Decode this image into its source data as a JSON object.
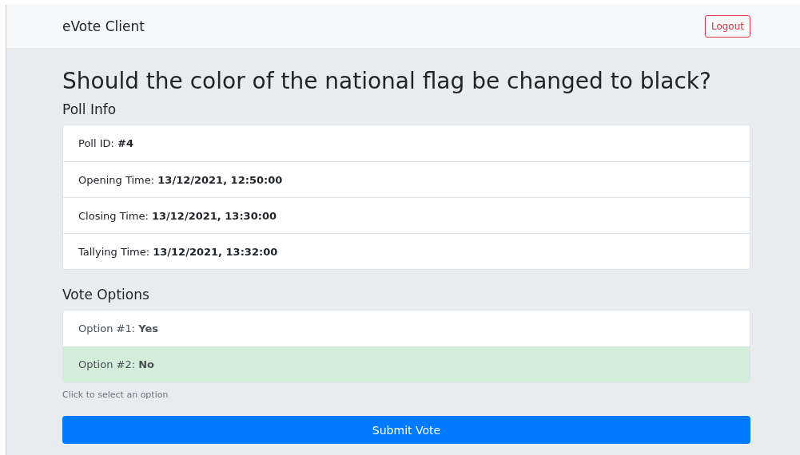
{
  "navbar": {
    "brand": "eVote Client",
    "logout": "Logout"
  },
  "poll": {
    "question": "Should the color of the national flag be changed to black?",
    "info_heading": "Poll Info",
    "info": [
      "Poll ID: **#4**",
      "Opening Time: **13/12/2021, 12:50:00**",
      "Closing Time: **13/12/2021, 13:30:00**",
      "Tallying Time: **13/12/2021, 13:32:00**"
    ],
    "options_heading": "Vote Options",
    "options": [
      {
        "text": "Option #1: **Yes**",
        "selected": false
      },
      {
        "text": "Option #2: **No**",
        "selected": true
      }
    ],
    "hint": "Click to select an option",
    "submit": "Submit Vote"
  }
}
